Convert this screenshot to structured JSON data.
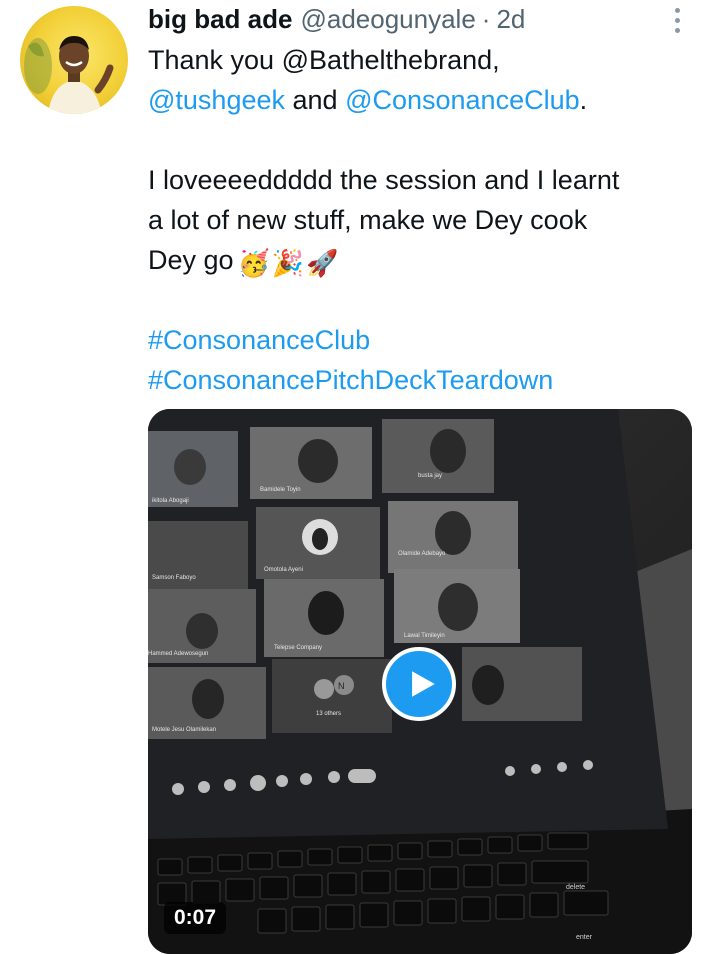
{
  "tweet": {
    "author_name": "big bad ade",
    "author_handle": "@adeogunyale",
    "separator": "·",
    "time": "2d",
    "lines": {
      "l1": {
        "text": "Thank you @Bathelthebrand,"
      },
      "l2": {
        "link1": "@tushgeek",
        "mid": " and ",
        "link2": "@ConsonanceClub",
        "end": "."
      },
      "l4": {
        "text": "I loveeeeddddd the session and I learnt"
      },
      "l5": {
        "text": "a lot of new stuff, make we Dey cook"
      },
      "l6": {
        "text": "Dey go",
        "emojis": "🥳🎉🚀"
      },
      "l8": {
        "hashtag": "#ConsonanceClub"
      },
      "l9": {
        "hashtag": "#ConsonancePitchDeckTeardown"
      }
    },
    "video": {
      "duration": "0:07",
      "participants": {
        "p1": "ikitola Abogaji",
        "p2": "Bamidele Toyin",
        "p3": "busta jay",
        "p4": "Omotola Ayeni",
        "p5": "Olamide Adebayo",
        "p6": "Samson Faboyo",
        "p7": "Hammed Adewosegun",
        "p8": "Telepse Company",
        "p9": "Lawal Timileyin",
        "p10": "Motele Jesu Olamilekan",
        "p11": "13 others",
        "p12": "N"
      },
      "keyboard_delete": "delete",
      "keyboard_enter": "enter"
    }
  },
  "colors": {
    "link": "#1d9bf0",
    "muted": "#536471",
    "text": "#0f1419"
  },
  "icons": {
    "avatar": "profile-photo",
    "more": "more-options-icon",
    "play": "play-icon"
  }
}
